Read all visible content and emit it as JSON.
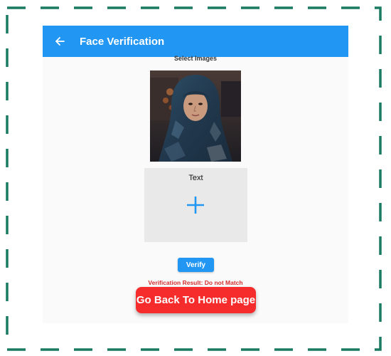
{
  "app_bar": {
    "title": "Face Verification",
    "back_icon": "arrow-left-icon",
    "color": "#2196f3"
  },
  "select_images": {
    "title": "Select Images",
    "first_image": "selected-face-photo",
    "second_picker": {
      "label": "Text",
      "icon": "plus-icon"
    }
  },
  "verify_button": {
    "label": "Verify",
    "color": "#2196f3"
  },
  "result": {
    "text": "Verification Result: Do not Match",
    "color": "#d32f2f"
  },
  "home_button": {
    "label": "Go Back To Home page",
    "color": "#f62b2b"
  },
  "frame": {
    "border_color": "#1a7a62"
  }
}
